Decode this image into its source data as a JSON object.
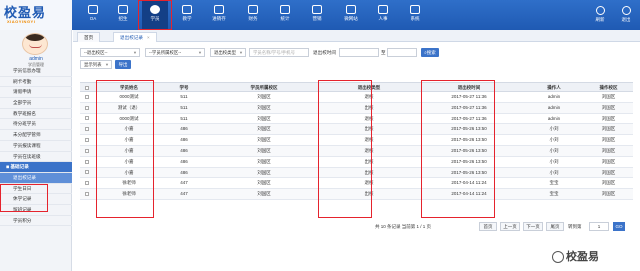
{
  "header": {
    "logo_text": "校盈易",
    "logo_sub": "XIAOYINGYI",
    "nav": [
      {
        "label": "OA",
        "icon": "oa-icon"
      },
      {
        "label": "招生",
        "icon": "enroll-icon"
      },
      {
        "label": "学员",
        "icon": "student-icon"
      },
      {
        "label": "教学",
        "icon": "teaching-icon"
      },
      {
        "label": "进销存",
        "icon": "inventory-icon"
      },
      {
        "label": "财务",
        "icon": "finance-icon"
      },
      {
        "label": "统计",
        "icon": "stats-icon"
      },
      {
        "label": "营销",
        "icon": "marketing-icon"
      },
      {
        "label": "微网站",
        "icon": "microsite-icon"
      },
      {
        "label": "人事",
        "icon": "hr-icon"
      },
      {
        "label": "系统",
        "icon": "system-icon"
      }
    ],
    "right": [
      {
        "label": "刷新",
        "icon": "refresh-icon"
      },
      {
        "label": "退出",
        "icon": "logout-icon"
      }
    ]
  },
  "sidebar": {
    "user_name": "admin",
    "user_school": "学员管理",
    "items": [
      {
        "label": "学员信息办理",
        "type": "item"
      },
      {
        "label": "刷卡考勤",
        "type": "item"
      },
      {
        "label": "请假申请",
        "type": "item"
      },
      {
        "label": "全部学员",
        "type": "item"
      },
      {
        "label": "教学班报名",
        "type": "item"
      },
      {
        "label": "待分班学员",
        "type": "item"
      },
      {
        "label": "未分配学管师",
        "type": "item"
      },
      {
        "label": "学员报读课程",
        "type": "item"
      },
      {
        "label": "学员在读班级",
        "type": "item"
      },
      {
        "label": "基础记录",
        "type": "group"
      },
      {
        "label": "退出校记录",
        "type": "active"
      },
      {
        "label": "学生日日",
        "type": "item"
      },
      {
        "label": "休学记录",
        "type": "item"
      },
      {
        "label": "留班记录",
        "type": "item"
      },
      {
        "label": "学员积分",
        "type": "item"
      }
    ]
  },
  "tabs": [
    {
      "label": "首页",
      "active": false
    },
    {
      "label": "退出校记录",
      "active": true
    }
  ],
  "filters": {
    "select1": "--退出校区--",
    "select2": "--学员所属校区--",
    "select3": "退出校类型",
    "search_placeholder": "学员名称/学号/手机号",
    "date_label": "退出校时间",
    "date_sep": "至",
    "search_button": "搜索",
    "show_select": "显示列表",
    "export_button": "导出"
  },
  "table": {
    "headers": [
      "",
      "学员姓名",
      "学号",
      "学员所属校区",
      "退出校类型",
      "退出校时间",
      "操作人",
      "操作校区"
    ],
    "rows": [
      [
        "0000测试",
        "511",
        "刘国区",
        "退校",
        "2017-05-27 11:36",
        "admin",
        "刘国区"
      ],
      [
        "测试（退）",
        "511",
        "刘国区",
        "出校",
        "2017-05-27 11:36",
        "admin",
        "刘国区"
      ],
      [
        "0000测试",
        "511",
        "刘国区",
        "退校",
        "2017-05-27 11:36",
        "admin",
        "刘国区"
      ],
      [
        "小嘉",
        "486",
        "刘国区",
        "出校",
        "2017-05-26 13:50",
        "小刘",
        "刘国区"
      ],
      [
        "小嘉",
        "486",
        "刘国区",
        "退校",
        "2017-05-26 13:50",
        "小刘",
        "刘国区"
      ],
      [
        "小嘉",
        "486",
        "刘国区",
        "退校",
        "2017-05-26 13:50",
        "小刘",
        "刘国区"
      ],
      [
        "小嘉",
        "486",
        "刘国区",
        "出校",
        "2017-05-26 13:50",
        "小刘",
        "刘国区"
      ],
      [
        "小嘉",
        "486",
        "刘国区",
        "出校",
        "2017-05-26 13:50",
        "小刘",
        "刘国区"
      ],
      [
        "徐老师",
        "447",
        "刘国区",
        "退校",
        "2017-04-14 11:24",
        "宝宝",
        "刘国区"
      ],
      [
        "徐老师",
        "447",
        "刘国区",
        "出校",
        "2017-04-14 11:24",
        "宝宝",
        "刘国区"
      ]
    ]
  },
  "pager": {
    "info": "共 10 条记录 当前第 1 / 1 页",
    "first": "首页",
    "prev": "上一页",
    "next": "下一页",
    "last": "尾页",
    "goto_label": "转到第",
    "page_value": "1",
    "go_button": "GO"
  },
  "watermark": {
    "text": "校盈易"
  }
}
